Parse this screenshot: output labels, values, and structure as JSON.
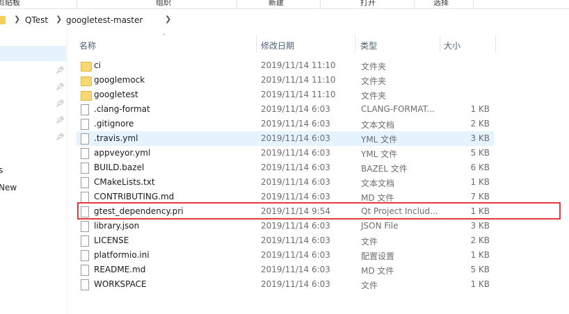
{
  "ribbon": {
    "groups": [
      "剪贴板",
      "组织",
      "新建",
      "打开",
      "选择"
    ]
  },
  "breadcrumb": {
    "items": [
      "QTest",
      "googletest-master"
    ]
  },
  "nav": {
    "partial_labels": [
      "s",
      "New"
    ]
  },
  "columns": {
    "name": "名称",
    "date": "修改日期",
    "type": "类型",
    "size": "大小"
  },
  "files": [
    {
      "name": "ci",
      "date": "2019/11/14 11:10",
      "type": "文件夹",
      "size": "",
      "icon": "folder-icon"
    },
    {
      "name": "googlemock",
      "date": "2019/11/14 11:10",
      "type": "文件夹",
      "size": "",
      "icon": "folder-icon"
    },
    {
      "name": "googletest",
      "date": "2019/11/14 11:10",
      "type": "文件夹",
      "size": "",
      "icon": "folder-icon"
    },
    {
      "name": ".clang-format",
      "date": "2019/11/14 6:03",
      "type": "CLANG-FORMAT...",
      "size": "1 KB",
      "icon": "file-icon"
    },
    {
      "name": ".gitignore",
      "date": "2019/11/14 6:03",
      "type": "文本文档",
      "size": "2 KB",
      "icon": "text-file-icon"
    },
    {
      "name": ".travis.yml",
      "date": "2019/11/14 6:03",
      "type": "YML 文件",
      "size": "3 KB",
      "icon": "file-icon"
    },
    {
      "name": "appveyor.yml",
      "date": "2019/11/14 6:03",
      "type": "YML 文件",
      "size": "5 KB",
      "icon": "file-icon"
    },
    {
      "name": "BUILD.bazel",
      "date": "2019/11/14 6:03",
      "type": "BAZEL 文件",
      "size": "6 KB",
      "icon": "file-icon"
    },
    {
      "name": "CMakeLists.txt",
      "date": "2019/11/14 6:03",
      "type": "文本文档",
      "size": "1 KB",
      "icon": "text-file-icon"
    },
    {
      "name": "CONTRIBUTING.md",
      "date": "2019/11/14 6:03",
      "type": "MD 文件",
      "size": "7 KB",
      "icon": "file-icon"
    },
    {
      "name": "gtest_dependency.pri",
      "date": "2019/11/14 9:54",
      "type": "Qt Project Includ...",
      "size": "1 KB",
      "icon": "pri-file-icon"
    },
    {
      "name": "library.json",
      "date": "2019/11/14 6:03",
      "type": "JSON File",
      "size": "3 KB",
      "icon": "json-file-icon"
    },
    {
      "name": "LICENSE",
      "date": "2019/11/14 6:03",
      "type": "文件",
      "size": "2 KB",
      "icon": "file-icon"
    },
    {
      "name": "platformio.ini",
      "date": "2019/11/14 6:03",
      "type": "配置设置",
      "size": "1 KB",
      "icon": "settings-file-icon"
    },
    {
      "name": "README.md",
      "date": "2019/11/14 6:03",
      "type": "MD 文件",
      "size": "5 KB",
      "icon": "file-icon"
    },
    {
      "name": "WORKSPACE",
      "date": "2019/11/14 6:03",
      "type": "文件",
      "size": "1 KB",
      "icon": "file-icon"
    }
  ],
  "selected_index": 5,
  "highlighted_index": 10,
  "colors": {
    "selection": "#e5f3ff",
    "highlight_box": "#e8383d",
    "folder": "#f8d775"
  }
}
